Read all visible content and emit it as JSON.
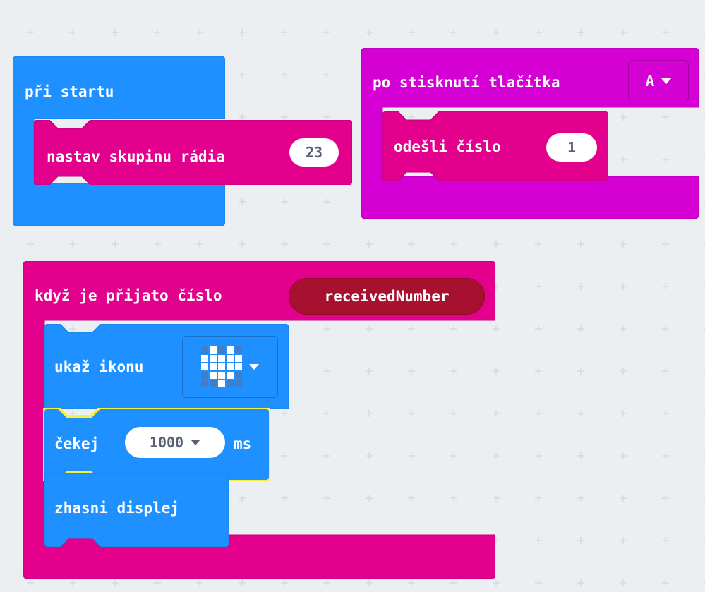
{
  "colors": {
    "workspace": "#eceff1",
    "basic_blue": "#1e90ff",
    "radio_pink": "#e3008c",
    "input_magenta": "#d400d4",
    "variable_red": "#a8102f",
    "highlight_yellow": "#f7f040",
    "pill_text": "#575e75"
  },
  "on_start": {
    "label": "při startu",
    "radio_group": {
      "label": "nastav skupinu rádia",
      "value": "23"
    }
  },
  "on_button": {
    "label": "po stisknutí tlačítka",
    "button_value": "A",
    "send_number": {
      "label": "odešli číslo",
      "value": "1"
    }
  },
  "on_received": {
    "label": "když je přijato číslo",
    "variable": "receivedNumber",
    "show_icon": {
      "label": "ukaž ikonu",
      "icon_name": "heart-icon",
      "matrix": [
        0,
        1,
        0,
        1,
        0,
        1,
        1,
        1,
        1,
        1,
        1,
        1,
        1,
        1,
        1,
        0,
        1,
        1,
        1,
        0,
        0,
        0,
        1,
        0,
        0
      ]
    },
    "pause": {
      "label": "čekej",
      "value": "1000",
      "unit": "ms"
    },
    "clear": {
      "label": "zhasni displej"
    }
  }
}
